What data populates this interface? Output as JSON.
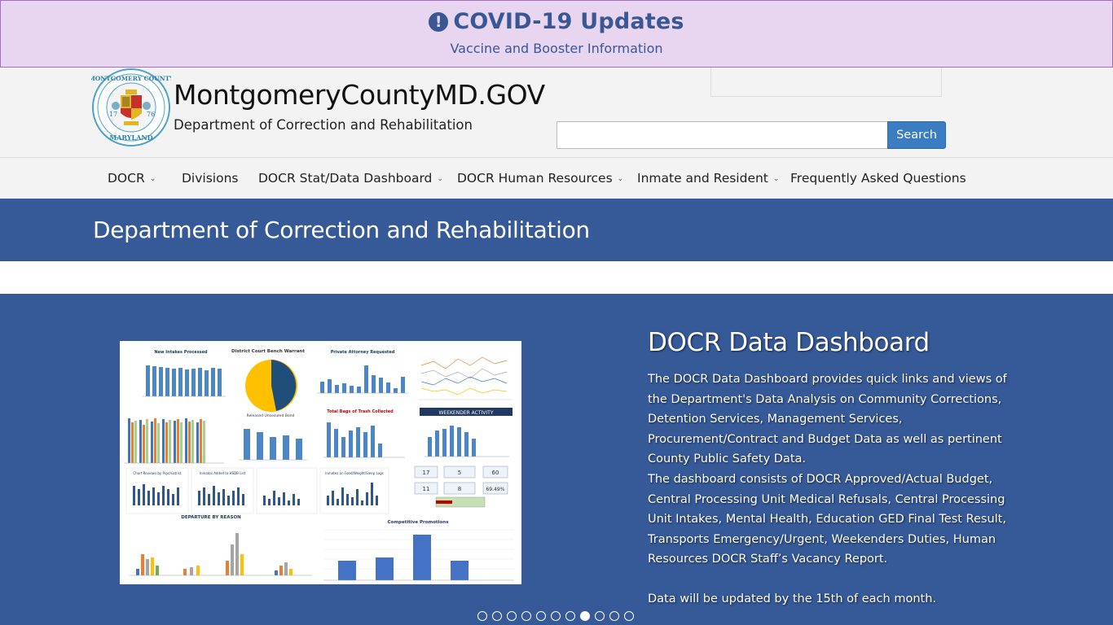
{
  "covid": {
    "icon": "exclamation-circle-icon",
    "title": "COVID-19 Updates",
    "subtitle": "Vaccine and Booster Information",
    "bg_color": "#e8d5f0",
    "text_color": "#3a5795"
  },
  "header": {
    "seal_icon": "montgomery-county-seal",
    "site_title": "MontgomeryCountyMD.GOV",
    "dept_name": "Department of Correction and Rehabilitation",
    "search_placeholder": "",
    "search_button": "Search"
  },
  "nav": {
    "items": [
      {
        "label": "DOCR",
        "dropdown": true
      },
      {
        "label": "Divisions",
        "dropdown": false
      },
      {
        "label": "DOCR Stat/Data Dashboard",
        "dropdown": true
      },
      {
        "label": "DOCR Human Resources",
        "dropdown": true
      },
      {
        "label": "Inmate and Resident",
        "dropdown": true
      },
      {
        "label": "Frequently Asked Questions",
        "dropdown": false
      }
    ]
  },
  "banner": {
    "title": "Department of Correction and Rehabilitation",
    "bg_color": "#365998"
  },
  "hero": {
    "title": "DOCR Data Dashboard",
    "paragraph1": "The DOCR Data Dashboard provides quick links and views of the Department's Data Analysis on Community Corrections, Detention Services, Management Services, Procurement/Contract and Budget Data as well as pertinent County Public Safety Data.",
    "paragraph2": "The dashboard consists of DOCR Approved/Actual Budget, Central Processing Unit Medical Refusals, Central Processing Unit Intakes, Mental Health, Education GED Final Test Result, Transports Emergency/Urgent, Weekenders Duties, Human Resources DOCR Staff’s Vacancy Report.",
    "paragraph3": "Data will be updated by the 15th of each month.",
    "slide_count": 11,
    "active_slide": 8,
    "dashboard_image": {
      "panels": [
        {
          "title": "New Intakes Processed"
        },
        {
          "title": "District Court Bench Warrant"
        },
        {
          "title": "Private Attorney Requested"
        },
        {
          "title": "Released Unsecured Bond"
        },
        {
          "title": "Total Bags of Trash Collected"
        },
        {
          "title": "WEEKENDER ACTIVITY"
        },
        {
          "title": "Chart Reviews by Psychiatrist"
        },
        {
          "title": "Inmates Added to HSDB List"
        },
        {
          "title": "Inmates on Food/Weight/Sleep Logs"
        },
        {
          "title": "DEPARTURE BY REASON"
        },
        {
          "title": "Competitive Promotions"
        }
      ],
      "kpi_values": [
        "17",
        "5",
        "60",
        "11",
        "8",
        "69.49%"
      ]
    }
  }
}
